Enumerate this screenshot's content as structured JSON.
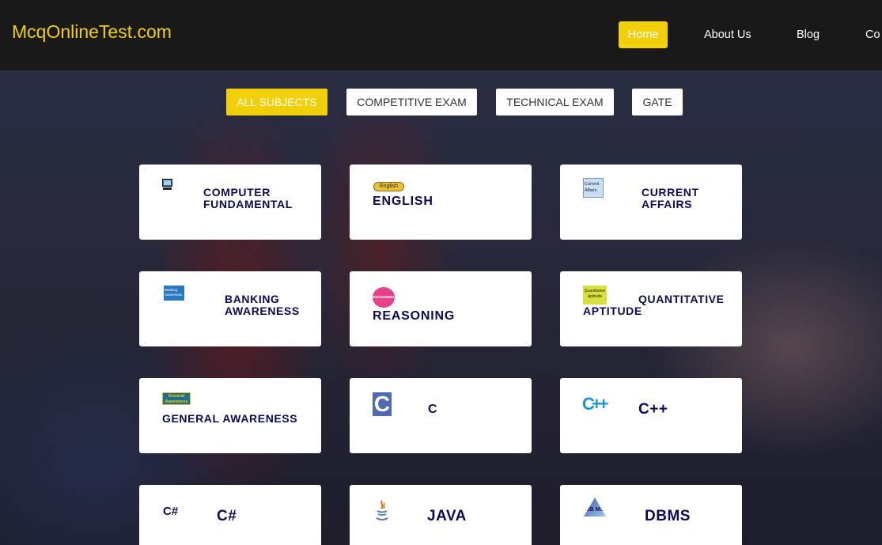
{
  "header": {
    "logo": "McqOnlineTest.com",
    "nav": [
      "Home",
      "About Us",
      "Blog",
      "Co"
    ]
  },
  "filters": [
    "ALL SUBJECTS",
    "COMPETITIVE EXAM",
    "TECHNICAL EXAM",
    "GATE"
  ],
  "cards": [
    {
      "title": "COMPUTER FUNDAMENTAL",
      "icon": "computer-icon"
    },
    {
      "title": "ENGLISH",
      "icon": "english-badge-icon",
      "icon_text": "English"
    },
    {
      "title": "CURRENT AFFAIRS",
      "icon": "current-affairs-icon",
      "icon_text": "Current Affairs"
    },
    {
      "title": "BANKING AWARENESS",
      "icon": "banking-icon",
      "icon_text": "Banking Awareness"
    },
    {
      "title": "REASONING",
      "icon": "reasoning-icon",
      "icon_text": "REASONING"
    },
    {
      "title": "QUANTITATIVE APTITUDE",
      "icon": "quantitative-aptitude-icon",
      "icon_text": "Quantitative Aptitude"
    },
    {
      "title": "GENERAL AWARENESS",
      "icon": "general-awareness-icon",
      "icon_text": "General Awareness"
    },
    {
      "title": "C",
      "icon": "c-language-icon",
      "icon_text": "C"
    },
    {
      "title": "C++",
      "icon": "cpp-icon",
      "icon_text": "C++"
    },
    {
      "title": "C#",
      "icon": "csharp-icon",
      "icon_text": "C#"
    },
    {
      "title": "JAVA",
      "icon": "java-icon"
    },
    {
      "title": "DBMS",
      "icon": "dbms-icon",
      "icon_text": "DB MS"
    }
  ],
  "colors": {
    "accent": "#f2d00a",
    "header_bg": "#191919",
    "title": "#0a0a5a"
  }
}
